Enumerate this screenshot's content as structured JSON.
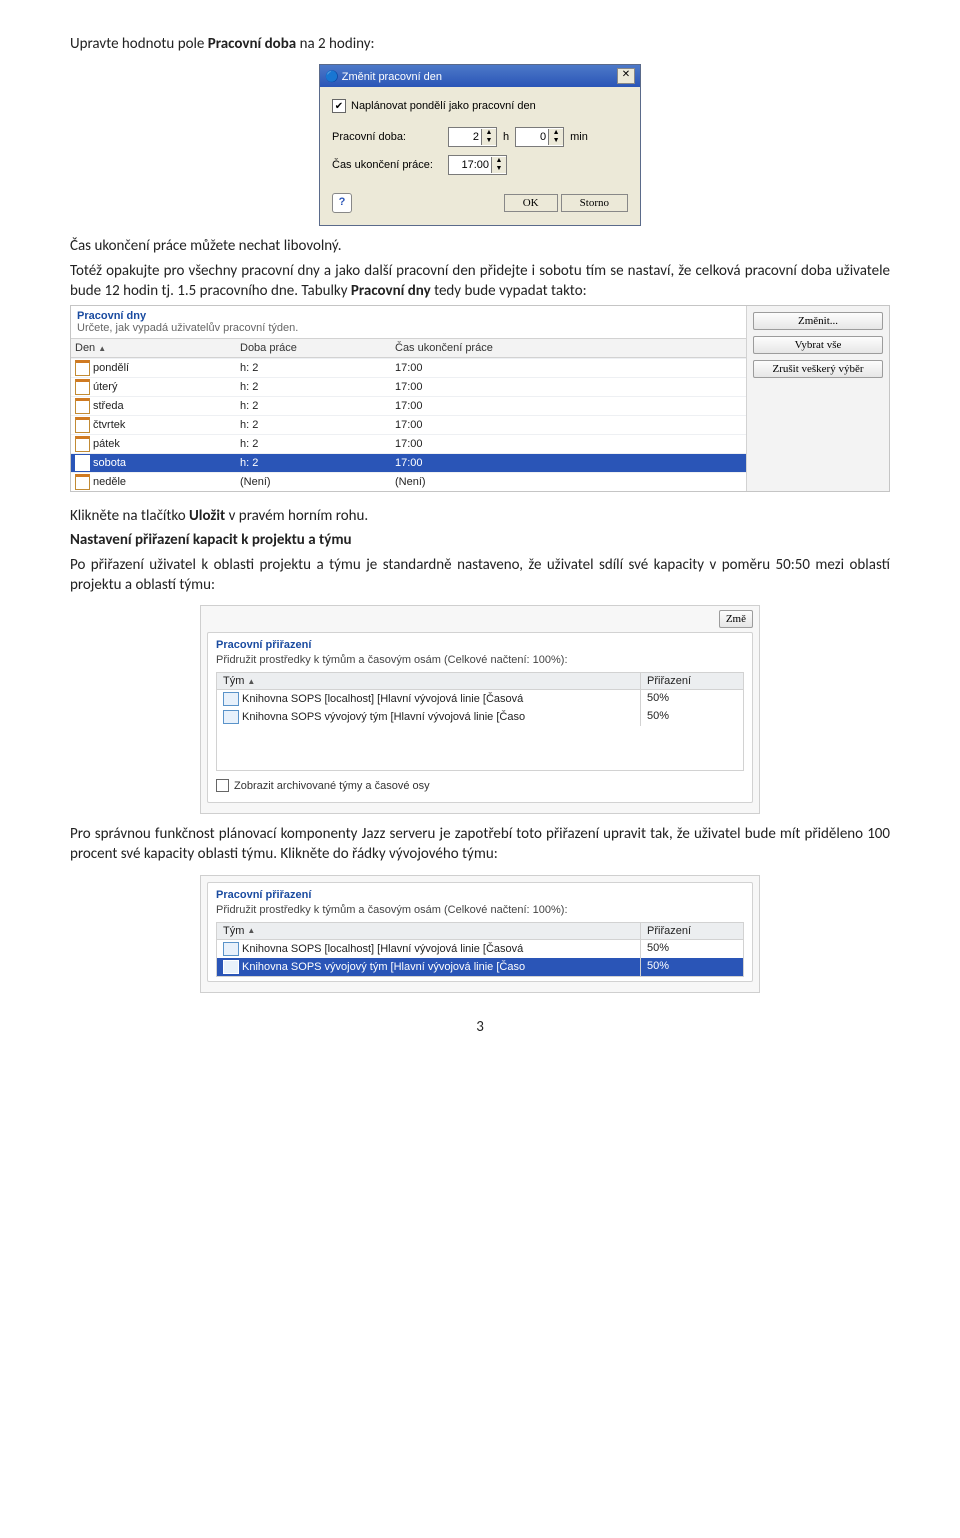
{
  "doc": {
    "p1a": "Upravte hodnotu pole ",
    "p1b": "Pracovní doba",
    "p1c": " na 2 hodiny:",
    "p2": "Čas ukončení práce můžete nechat libovolný.",
    "p3a": "Totéž opakujte pro všechny pracovní dny a jako další pracovní den přidejte i sobotu tím se nastaví, že celková pracovní doba uživatele bude 12 hodin tj. 1.5 pracovního dne. Tabulky ",
    "p3b": "Pracovní dny",
    "p3c": " tedy bude vypadat takto:",
    "p4a": "Klikněte na tlačítko ",
    "p4b": "Uložit",
    "p4c": " v pravém horním rohu.",
    "h1": "Nastavení přiřazení kapacit k projektu a týmu",
    "p5": "Po přiřazení uživatel k oblasti projektu a týmu je standardně nastaveno, že uživatel sdílí své kapacity v poměru 50:50 mezi oblastí projektu a oblastí týmu:",
    "p6": "Pro správnou funkčnost plánovací komponenty Jazz serveru je zapotřebí toto přiřazení upravit tak, že uživatel bude mít přiděleno 100 procent své kapacity oblasti týmu. Klikněte do řádky vývojového týmu:",
    "pagen": "3"
  },
  "dialog": {
    "title": "Změnit pracovní den",
    "chk": "Naplánovat pondělí jako pracovní den",
    "hours_lbl": "Pracovní doba:",
    "hours_val": "2",
    "h_unit": "h",
    "min_val": "0",
    "min_unit": "min",
    "end_lbl": "Čas ukončení práce:",
    "end_val": "17:00",
    "ok": "OK",
    "cancel": "Storno"
  },
  "tbl": {
    "title": "Pracovní dny",
    "desc": "Určete, jak vypadá uživatelův pracovní týden.",
    "h_den": "Den",
    "h_doba": "Doba práce",
    "h_cas": "Čas ukončení práce",
    "rows": [
      {
        "d": "pondělí",
        "w": "h: 2",
        "e": "17:00",
        "sel": false
      },
      {
        "d": "úterý",
        "w": "h: 2",
        "e": "17:00",
        "sel": false
      },
      {
        "d": "středa",
        "w": "h: 2",
        "e": "17:00",
        "sel": false
      },
      {
        "d": "čtvrtek",
        "w": "h: 2",
        "e": "17:00",
        "sel": false
      },
      {
        "d": "pátek",
        "w": "h: 2",
        "e": "17:00",
        "sel": false
      },
      {
        "d": "sobota",
        "w": "h: 2",
        "e": "17:00",
        "sel": true
      },
      {
        "d": "neděle",
        "w": "(Není)",
        "e": "(Není)",
        "sel": false
      }
    ],
    "b1": "Změnit...",
    "b2": "Vybrat vše",
    "b3": "Zrušit veškerý výběr"
  },
  "assign": {
    "btn_top": "Změ",
    "title": "Pracovní přiřazení",
    "desc": "Přidružit prostředky k týmům a časovým osám (Celkové načtení: 100%):",
    "h_tym": "Tým",
    "h_pri": "Přiřazení",
    "rows1": [
      {
        "n": "Knihovna SOPS [localhost] [Hlavní vývojová linie [Časová",
        "p": "50%",
        "sel": false
      },
      {
        "n": "Knihovna SOPS vývojový tým [Hlavní vývojová linie [Časo",
        "p": "50%",
        "sel": false
      }
    ],
    "arch": "Zobrazit archivované týmy a časové osy",
    "rows2": [
      {
        "n": "Knihovna SOPS [localhost] [Hlavní vývojová linie [Časová",
        "p": "50%",
        "sel": false
      },
      {
        "n": "Knihovna SOPS vývojový tým [Hlavní vývojová linie [Časo",
        "p": "50%",
        "sel": true
      }
    ]
  }
}
